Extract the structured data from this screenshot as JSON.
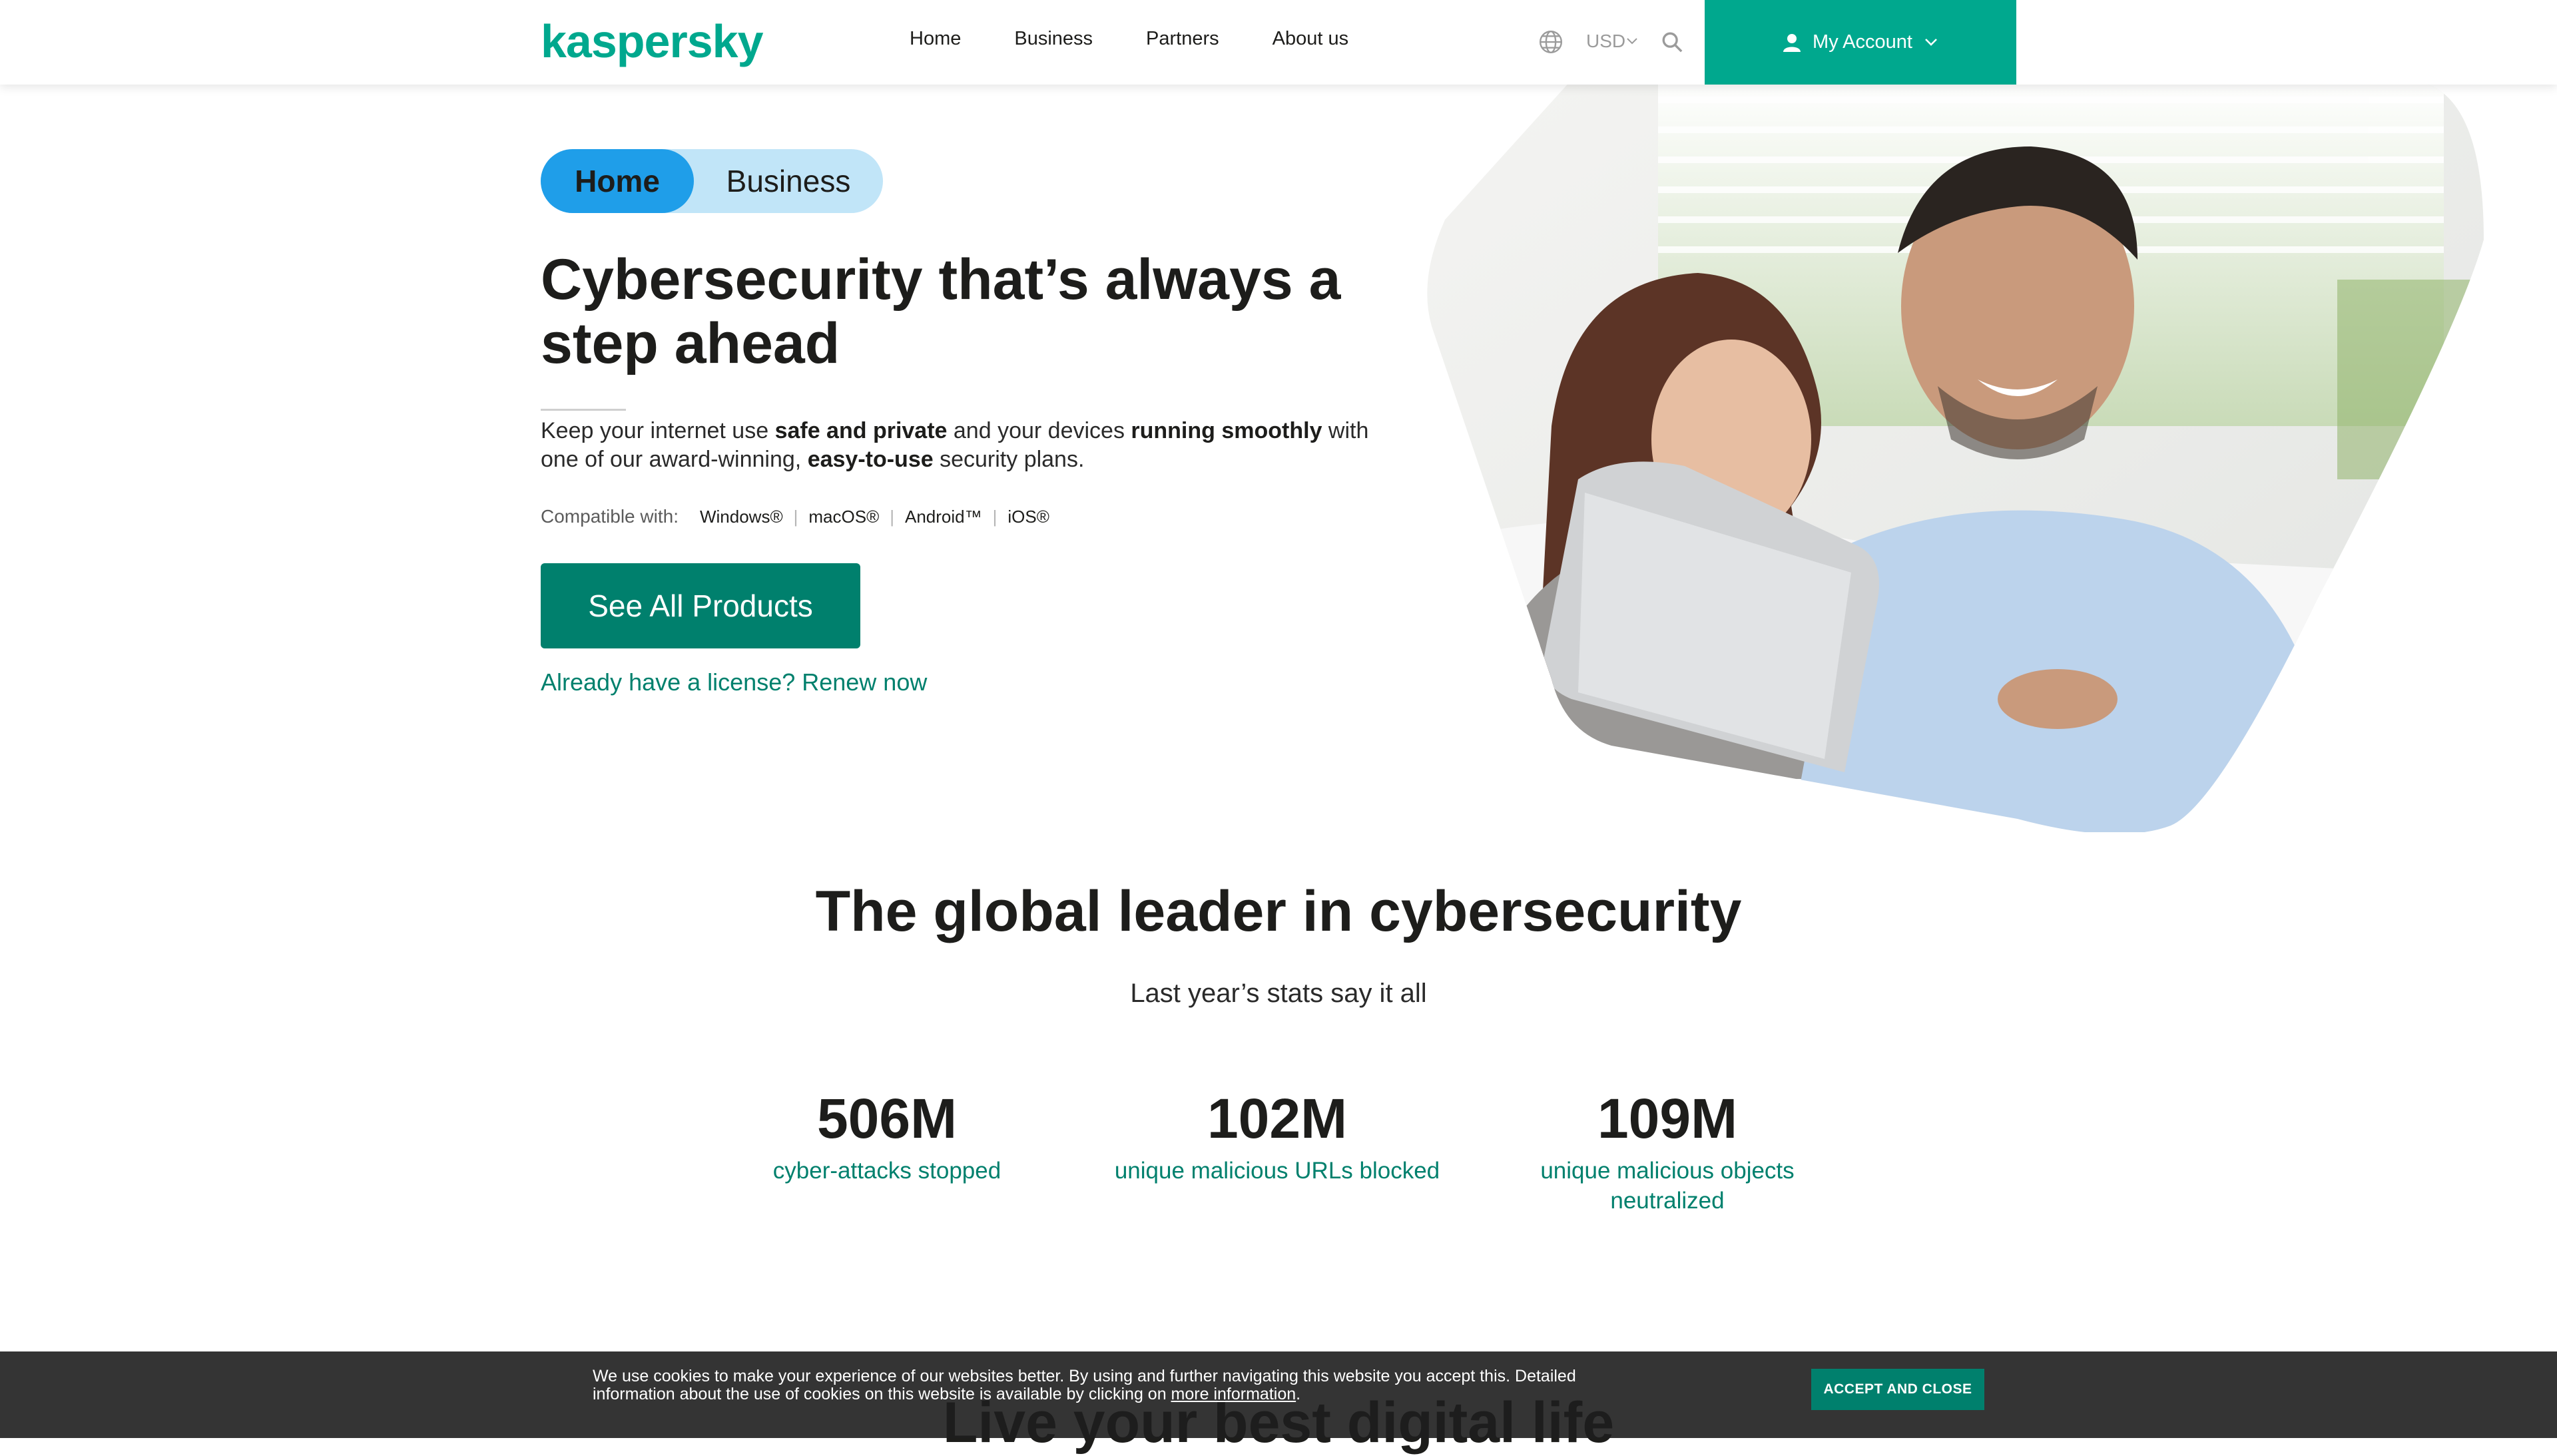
{
  "header": {
    "logo": "kaspersky",
    "nav": [
      "Home",
      "Business",
      "Partners",
      "About us"
    ],
    "currency": "USD",
    "account_label": "My Account"
  },
  "hero": {
    "toggle": {
      "active": "Home",
      "inactive": "Business"
    },
    "title": "Cybersecurity that’s always a step ahead",
    "desc": {
      "p1": "Keep your internet use ",
      "b1": "safe and private",
      "p2": " and your devices ",
      "b2": "running smoothly",
      "p3": " with one of our award-winning, ",
      "b3": "easy-to-use",
      "p4": " security plans."
    },
    "compat_label": "Compatible with:",
    "os": [
      "Windows®",
      "macOS®",
      "Android™",
      "iOS®"
    ],
    "cta": "See All Products",
    "renew": "Already have a license? Renew now"
  },
  "stats": {
    "title": "The global leader in cybersecurity",
    "subtitle": "Last year’s stats say it all",
    "items": [
      {
        "value": "506M",
        "label": "cyber-attacks stopped"
      },
      {
        "value": "102M",
        "label": "unique malicious URLs blocked"
      },
      {
        "value": "109M",
        "label": "unique malicious objects neutralized"
      }
    ]
  },
  "next_section_title": "Live your best digital life",
  "cookie": {
    "text": "We use cookies to make your experience of our websites better. By using and further navigating this website you accept this. Detailed information about the use of cookies on this website is available by clicking on ",
    "link": "more information",
    "end": ".",
    "button": "ACCEPT AND CLOSE"
  },
  "colors": {
    "brand": "#00a88e",
    "cta": "#00806d",
    "toggle_active": "#1f9ee9",
    "toggle_bg": "#c1e5f8"
  }
}
